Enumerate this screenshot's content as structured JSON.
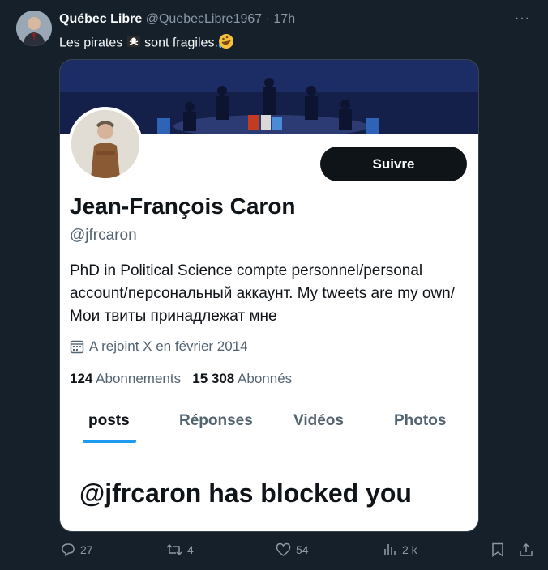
{
  "tweet": {
    "author_name": "Québec Libre",
    "author_handle": "@QuebecLibre1967",
    "separator": "·",
    "time": "17h",
    "text_before": "Les pirates",
    "text_middle": "sont fragiles.",
    "emoji_1": "pirate-flag",
    "emoji_2": "rolling-on-floor-laughing"
  },
  "card": {
    "follow_label": "Suivre",
    "name": "Jean-François Caron",
    "handle": "@jfrcaron",
    "bio": "PhD in Political Science compte personnel/personal account/персональный аккаунт. My tweets are my own/Мои твиты принадлежат мне",
    "joined": "A rejoint X en février 2014",
    "following_count": "124",
    "following_label": "Abonnements",
    "followers_count": "15 308",
    "followers_label": "Abonnés",
    "tabs": [
      "posts",
      "Réponses",
      "Vidéos",
      "Photos"
    ],
    "active_tab": "posts",
    "blocked_message": "@jfrcaron has blocked you"
  },
  "actions": {
    "replies": "27",
    "reposts": "4",
    "likes": "54",
    "views": "2 k"
  },
  "colors": {
    "background": "#15202b",
    "accent": "#1d9bf0",
    "muted": "#8b98a5",
    "follow_button": "#0f1419"
  }
}
